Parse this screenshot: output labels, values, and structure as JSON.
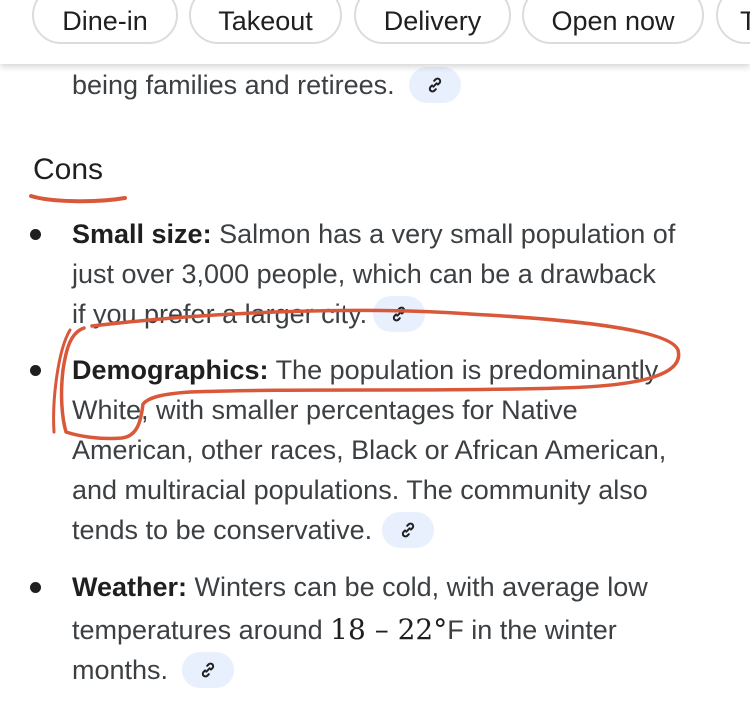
{
  "filter_chips": [
    "Dine-in",
    "Takeout",
    "Delivery",
    "Open now",
    "T"
  ],
  "intro_line": "being families and retirees.",
  "cons_heading": "Cons",
  "cons": [
    {
      "title": "Small size:",
      "lines": [
        "Salmon has a very small population of",
        "just over 3,000 people, which can be a drawback",
        "if you prefer a larger city."
      ]
    },
    {
      "title": "Demographics:",
      "lines": [
        "The population is predominantly",
        "White, with smaller percentages for Native",
        "American, other races, Black or African American,",
        "and multiracial populations. The community also",
        "tends to be conservative."
      ]
    },
    {
      "title": "Weather:",
      "lines": [
        "Winters can be cold, with average low",
        "temperatures around",
        "18 – 22°",
        "F in the winter",
        "months."
      ]
    }
  ],
  "colors": {
    "annotation": "#d9583a",
    "link_chip_bg": "#e8f0fe",
    "chip_border": "#dadce0"
  },
  "icons": {
    "link": "link-icon"
  }
}
